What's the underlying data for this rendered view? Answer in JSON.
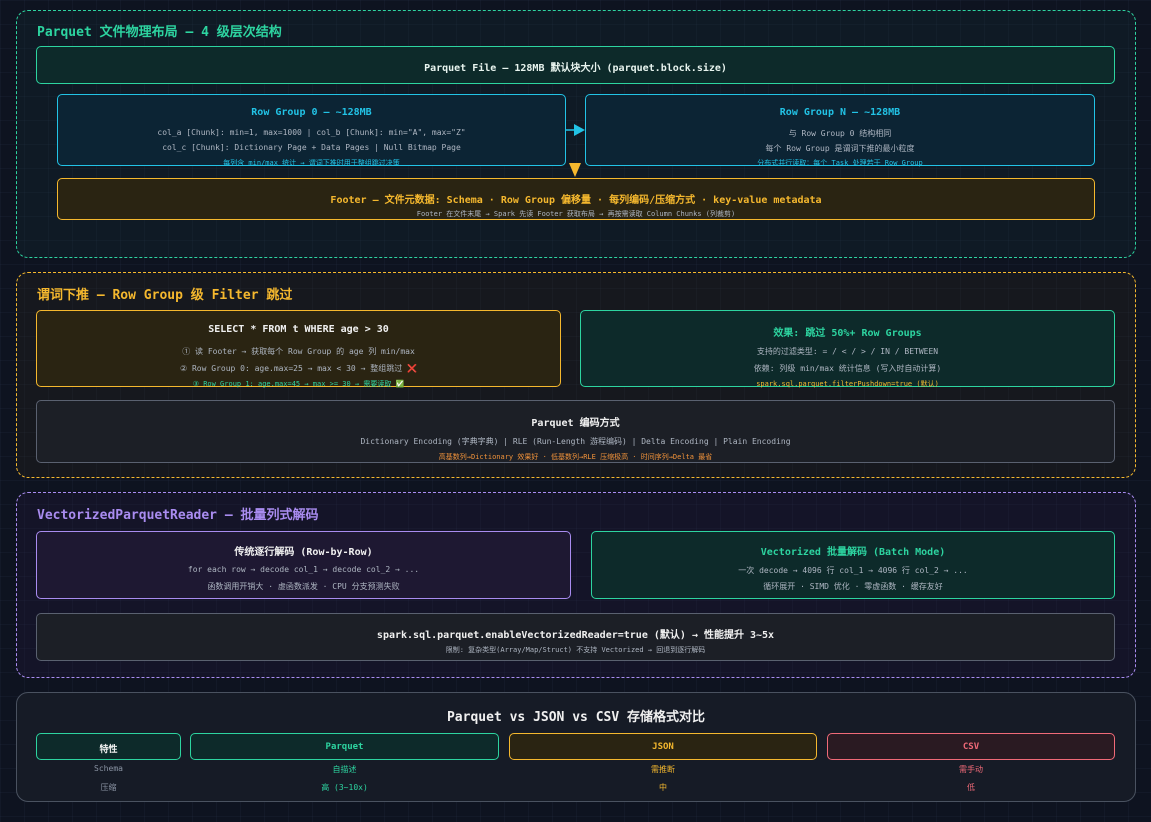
{
  "layout_section": {
    "title": "Parquet 文件物理布局 — 4 级层次结构",
    "file_box": "Parquet File — 128MB 默认块大小 (parquet.block.size)",
    "row_group_0": {
      "title": "Row Group 0 — ~128MB",
      "line1": "col_a [Chunk]: min=1, max=1000 | col_b [Chunk]: min=\"A\", max=\"Z\"",
      "line2": "col_c [Chunk]: Dictionary Page + Data Pages | Null Bitmap Page",
      "note": "每列含 min/max 统计 → 谓词下推时用于整组跳过决策"
    },
    "row_group_n": {
      "title": "Row Group N — ~128MB",
      "line1": "与 Row Group 0 结构相同",
      "line2": "每个 Row Group 是谓词下推的最小粒度",
      "note": "分布式并行读取：每个 Task 处理若干 Row Group"
    },
    "footer": {
      "title": "Footer — 文件元数据: Schema · Row Group 偏移量 · 每列编码/压缩方式 · key-value metadata",
      "line1": "Footer 在文件末尾 → Spark 先读 Footer 获取布局 → 再按需读取 Column Chunks (列裁剪)"
    }
  },
  "pushdown_section": {
    "title": "谓词下推 — Row Group 级 Filter 跳过",
    "query_box": {
      "title": "SELECT * FROM t WHERE age > 30",
      "line1": "① 读 Footer → 获取每个 Row Group 的 age 列 min/max",
      "line2": "② Row Group 0: age.max=25 → max < 30 → 整组跳过 ❌",
      "note": "③ Row Group 1: age.max=45 → max >= 30 → 需要读取 ✅"
    },
    "effect_box": {
      "title": "效果: 跳过 50%+ Row Groups",
      "line1": "支持的过滤类型: = / < / > / IN / BETWEEN",
      "line2": "依赖: 列级 min/max 统计信息 (写入时自动计算)",
      "note": "spark.sql.parquet.filterPushdown=true (默认)"
    },
    "encoding_box": {
      "title": "Parquet 编码方式",
      "line1": "Dictionary Encoding (字典字典) | RLE (Run-Length 游程编码) | Delta Encoding | Plain Encoding",
      "note": "高基数列→Dictionary 效果好 · 低基数列→RLE 压缩极高 · 时间序列→Delta 最省"
    }
  },
  "vector_section": {
    "title": "VectorizedParquetReader — 批量列式解码",
    "row_box": {
      "title": "传统逐行解码 (Row-by-Row)",
      "line1": "for each row → decode col_1 → decode col_2 → ...",
      "line2": "函数调用开销大 · 虚函数派发 · CPU 分支预测失败"
    },
    "batch_box": {
      "title": "Vectorized 批量解码 (Batch Mode)",
      "line1": "一次 decode → 4096 行 col_1 → 4096 行 col_2 → ...",
      "line2": "循环展开 · SIMD 优化 · 零虚函数 · 缓存友好"
    },
    "config_box": {
      "title": "spark.sql.parquet.enableVectorizedReader=true (默认) → 性能提升 3~5x",
      "line1": "限制: 复杂类型(Array/Map/Struct) 不支持 Vectorized → 回退到逐行解码"
    }
  },
  "compare_section": {
    "title": "Parquet vs JSON vs CSV 存储格式对比",
    "headers": [
      "特性",
      "Parquet",
      "JSON",
      "CSV"
    ],
    "rows": [
      [
        "Schema",
        "自描述",
        "需推断",
        "需手动"
      ],
      [
        "压缩",
        "高 (3~10x)",
        "中",
        "低"
      ]
    ]
  },
  "colors": {
    "teal": "#2dd4a0",
    "cyan": "#22c3e6",
    "amber": "#f5b82e",
    "purple": "#a98cf0",
    "red": "#f06a78",
    "gray": "#8a93a3"
  }
}
